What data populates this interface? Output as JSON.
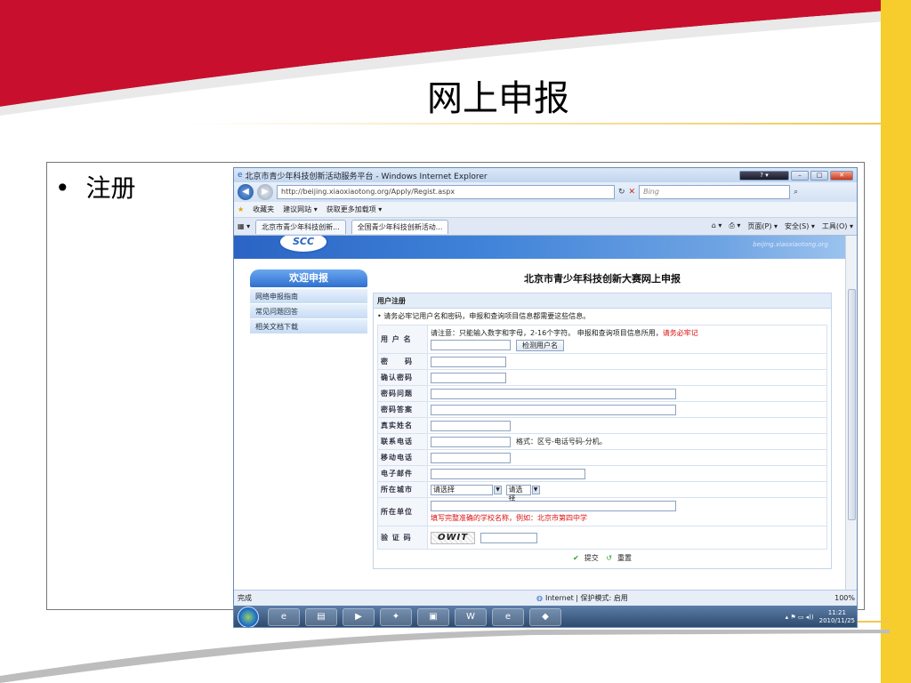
{
  "slide": {
    "title": "网上申报",
    "bullet": "注册"
  },
  "colors": {
    "accent_red": "#c8102e",
    "accent_yellow": "#f6cd2c",
    "ie_blue": "#2b64c4"
  },
  "ie": {
    "window_title": "北京市青少年科技创新活动服务平台 - Windows Internet Explorer",
    "address": "http://beijing.xiaoxiaotong.org/Apply/Regist.aspx",
    "search_placeholder": "Bing",
    "favorites": [
      "收藏夹",
      "建议网站 ▾",
      "获取更多加载项 ▾"
    ],
    "tabs": [
      "北京市青少年科技创新...",
      "全国青少年科技创新活动..."
    ],
    "commands": [
      "页面(P) ▾",
      "安全(S) ▾",
      "工具(O) ▾"
    ],
    "status_left": "完成",
    "status_zone": "Internet | 保护模式: 启用",
    "status_zoom": "100%"
  },
  "page": {
    "banner_logo": "SCC",
    "banner_url": "beijing.xiaoxiaotong.org",
    "welcome": "欢迎申报",
    "nav_items": [
      "网络申报指南",
      "常见问题回答",
      "相关文档下载"
    ],
    "form_title": "北京市青少年科技创新大赛网上申报",
    "section": "用户注册",
    "note": "• 请务必牢记用户名和密码，申报和查询项目信息都需要这些信息。",
    "fields": {
      "username": "用 户 名",
      "username_hint": "请注意：只能输入数字和字母，2-16个字符。 申报和查询项目信息所用，",
      "username_hint_red": "请务必牢记",
      "check_btn": "检测用户名",
      "password": "密　　码",
      "confirm": "确认密码",
      "question": "密码问题",
      "answer": "密码答案",
      "realname": "真实姓名",
      "phone": "联系电话",
      "phone_hint": "格式：区号-电话号码-分机。",
      "mobile": "移动电话",
      "email": "电子邮件",
      "city": "所在城市",
      "city_select1": "请选择",
      "city_select2": "请选择",
      "unit": "所在单位",
      "unit_hint": "填写完整准确的学校名称，例如：北京市第四中学",
      "captcha_label": "验 证 码",
      "captcha_text": "OWIT"
    },
    "submit": "提交",
    "reset": "重置"
  },
  "taskbar": {
    "time": "11:21",
    "date": "2010/11/25"
  }
}
